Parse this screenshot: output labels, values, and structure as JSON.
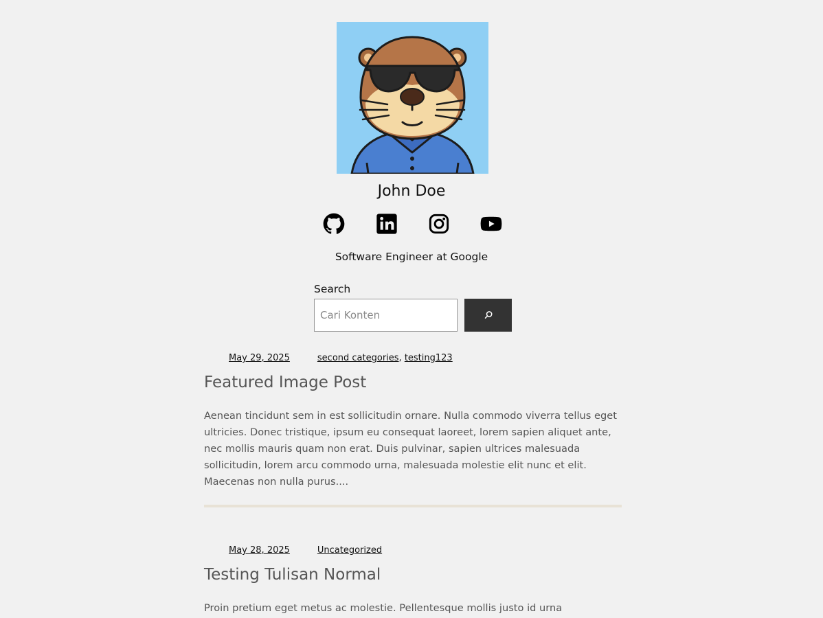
{
  "profile": {
    "name": "John Doe",
    "tagline": "Software Engineer at Google",
    "avatar_icon": "otter-sunglasses-avatar",
    "avatar_bg": "#8fcff4"
  },
  "socials": [
    {
      "icon": "github-icon",
      "label": "GitHub"
    },
    {
      "icon": "linkedin-icon",
      "label": "LinkedIn"
    },
    {
      "icon": "instagram-icon",
      "label": "Instagram"
    },
    {
      "icon": "youtube-icon",
      "label": "YouTube"
    }
  ],
  "search": {
    "label": "Search",
    "placeholder": "Cari Konten",
    "value": "",
    "button_icon": "search-icon",
    "button_color": "#333333"
  },
  "posts": [
    {
      "date": "May 29, 2025",
      "categories": [
        "second categories",
        "testing123"
      ],
      "title": "Featured Image Post",
      "excerpt": "Aenean tincidunt sem in est sollicitudin ornare. Nulla commodo viverra tellus eget ultricies. Donec tristique, ipsum eu consequat laoreet, lorem sapien aliquet ante, nec mollis mauris quam non erat. Duis pulvinar, sapien ultrices malesuada sollicitudin, lorem arcu commodo urna, malesuada molestie elit nunc et elit. Maecenas non nulla purus...."
    },
    {
      "date": "May 28, 2025",
      "categories": [
        "Uncategorized"
      ],
      "title": "Testing Tulisan Normal",
      "excerpt": "Proin pretium eget metus ac molestie. Pellentesque mollis justo id urna"
    }
  ],
  "colors": {
    "background": "#f1f1f1",
    "separator": "#e8e2d6",
    "text_muted": "#555555"
  }
}
